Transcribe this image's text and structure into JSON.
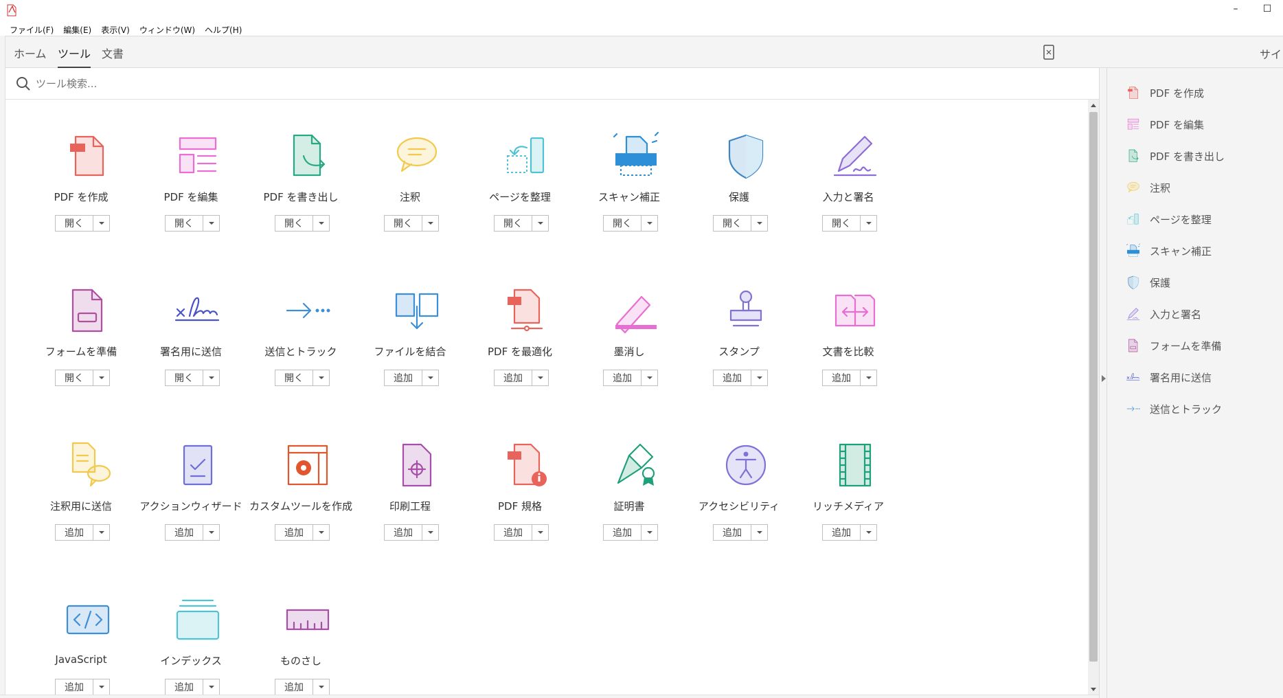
{
  "menu": [
    "ファイル(F)",
    "編集(E)",
    "表示(V)",
    "ウィンドウ(W)",
    "ヘルプ(H)"
  ],
  "window_controls": [
    "–",
    "☐"
  ],
  "tabs": [
    {
      "label": "ホーム",
      "active": false
    },
    {
      "label": "ツール",
      "active": true
    },
    {
      "label": "文書",
      "active": false
    }
  ],
  "sign_label": "サイン",
  "search": {
    "placeholder": "ツール検索..."
  },
  "tools": [
    {
      "label": "PDF を作成",
      "button": "開く",
      "icon": "create-pdf-icon",
      "color": "#e8645a"
    },
    {
      "label": "PDF を編集",
      "button": "開く",
      "icon": "edit-pdf-icon",
      "color": "#e86ed1"
    },
    {
      "label": "PDF を書き出し",
      "button": "開く",
      "icon": "export-pdf-icon",
      "color": "#26a882"
    },
    {
      "label": "注釈",
      "button": "開く",
      "icon": "comment-icon",
      "color": "#f2c94c"
    },
    {
      "label": "ページを整理",
      "button": "開く",
      "icon": "organize-pages-icon",
      "color": "#4fc3d4"
    },
    {
      "label": "スキャン補正",
      "button": "開く",
      "icon": "scan-icon",
      "color": "#2d8fd8"
    },
    {
      "label": "保護",
      "button": "開く",
      "icon": "shield-icon",
      "color": "#3d86c6"
    },
    {
      "label": "入力と署名",
      "button": "開く",
      "icon": "fill-sign-icon",
      "color": "#8c6cd8"
    },
    {
      "label": "フォームを準備",
      "button": "開く",
      "icon": "prepare-form-icon",
      "color": "#b04ea0"
    },
    {
      "label": "署名用に送信",
      "button": "開く",
      "icon": "send-signature-icon",
      "color": "#4a52c8"
    },
    {
      "label": "送信とトラック",
      "button": "開く",
      "icon": "send-track-icon",
      "color": "#3d8ed8"
    },
    {
      "label": "ファイルを結合",
      "button": "追加",
      "icon": "combine-files-icon",
      "color": "#3d8ed8"
    },
    {
      "label": "PDF を最適化",
      "button": "追加",
      "icon": "optimize-pdf-icon",
      "color": "#e8645a"
    },
    {
      "label": "墨消し",
      "button": "追加",
      "icon": "redact-icon",
      "color": "#e86ed1"
    },
    {
      "label": "スタンプ",
      "button": "追加",
      "icon": "stamp-icon",
      "color": "#7f71d8"
    },
    {
      "label": "文書を比較",
      "button": "追加",
      "icon": "compare-icon",
      "color": "#e86ed1"
    },
    {
      "label": "注釈用に送信",
      "button": "追加",
      "icon": "send-comments-icon",
      "color": "#f2c94c"
    },
    {
      "label": "アクションウィザード",
      "button": "追加",
      "icon": "action-wizard-icon",
      "color": "#6e6ed8"
    },
    {
      "label": "カスタムツールを作成",
      "button": "追加",
      "icon": "custom-tool-icon",
      "color": "#e2562e"
    },
    {
      "label": "印刷工程",
      "button": "追加",
      "icon": "print-production-icon",
      "color": "#a74fa8"
    },
    {
      "label": "PDF 規格",
      "button": "追加",
      "icon": "pdf-standards-icon",
      "color": "#e8645a"
    },
    {
      "label": "証明書",
      "button": "追加",
      "icon": "certificate-icon",
      "color": "#1fa07a"
    },
    {
      "label": "アクセシビリティ",
      "button": "追加",
      "icon": "accessibility-icon",
      "color": "#7f71d8"
    },
    {
      "label": "リッチメディア",
      "button": "追加",
      "icon": "rich-media-icon",
      "color": "#1fa07a"
    },
    {
      "label": "JavaScript",
      "button": "追加",
      "icon": "javascript-icon",
      "color": "#3d8ed8"
    },
    {
      "label": "インデックス",
      "button": "追加",
      "icon": "index-icon",
      "color": "#4fc3d4"
    },
    {
      "label": "ものさし",
      "button": "追加",
      "icon": "measure-icon",
      "color": "#a74fa8"
    }
  ],
  "right_pane": [
    {
      "label": "PDF を作成",
      "icon": "create-pdf-icon",
      "color": "#e8645a"
    },
    {
      "label": "PDF を編集",
      "icon": "edit-pdf-icon",
      "color": "#e86ed1"
    },
    {
      "label": "PDF を書き出し",
      "icon": "export-pdf-icon",
      "color": "#26a882"
    },
    {
      "label": "注釈",
      "icon": "comment-icon",
      "color": "#f2c94c"
    },
    {
      "label": "ページを整理",
      "icon": "organize-pages-icon",
      "color": "#4fc3d4"
    },
    {
      "label": "スキャン補正",
      "icon": "scan-icon",
      "color": "#2d8fd8"
    },
    {
      "label": "保護",
      "icon": "shield-icon",
      "color": "#3d86c6"
    },
    {
      "label": "入力と署名",
      "icon": "fill-sign-icon",
      "color": "#8c6cd8"
    },
    {
      "label": "フォームを準備",
      "icon": "prepare-form-icon",
      "color": "#b04ea0"
    },
    {
      "label": "署名用に送信",
      "icon": "send-signature-icon",
      "color": "#4a52c8"
    },
    {
      "label": "送信とトラック",
      "icon": "send-track-icon",
      "color": "#3d8ed8"
    }
  ]
}
